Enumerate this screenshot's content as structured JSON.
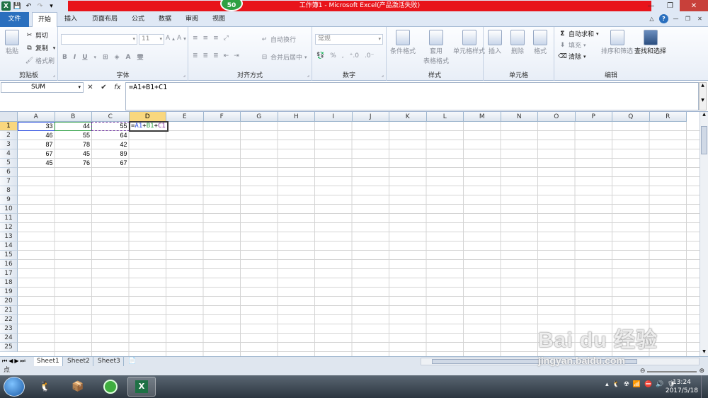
{
  "window": {
    "title": "工作簿1 - Microsoft Excel(产品激活失败)",
    "badge": "50"
  },
  "tabs": [
    {
      "label": "文件"
    },
    {
      "label": "开始"
    },
    {
      "label": "插入"
    },
    {
      "label": "页面布局"
    },
    {
      "label": "公式"
    },
    {
      "label": "数据"
    },
    {
      "label": "审阅"
    },
    {
      "label": "视图"
    }
  ],
  "ribbon": {
    "clipboard": {
      "title": "剪贴板",
      "paste": "粘贴",
      "cut": "剪切",
      "copy": "复制",
      "format_painter": "格式刷"
    },
    "font": {
      "title": "字体",
      "font_size": "11",
      "bold": "B",
      "italic": "I",
      "underline": "U"
    },
    "alignment": {
      "title": "对齐方式",
      "wrap_text": "自动换行",
      "merge_center": "合并后居中"
    },
    "number": {
      "title": "数字",
      "format": "常规"
    },
    "styles": {
      "title": "样式",
      "conditional": "条件格式",
      "table_line1": "套用",
      "table_line2": "表格格式",
      "cell_styles": "单元格样式"
    },
    "cells": {
      "title": "单元格",
      "insert": "插入",
      "delete": "删除",
      "format": "格式"
    },
    "editing": {
      "title": "编辑",
      "autosum": "自动求和",
      "fill": "填充",
      "clear": "清除",
      "sort_filter": "排序和筛选",
      "find_select": "查找和选择"
    }
  },
  "formula_bar": {
    "name_box": "SUM",
    "formula": "=A1+B1+C1"
  },
  "columns": [
    "A",
    "B",
    "C",
    "D",
    "E",
    "F",
    "G",
    "H",
    "I",
    "J",
    "K",
    "L",
    "M",
    "N",
    "O",
    "P",
    "Q",
    "R"
  ],
  "rows": [
    "1",
    "2",
    "3",
    "4",
    "5",
    "6",
    "7",
    "8",
    "9",
    "10",
    "11",
    "12",
    "13",
    "14",
    "15",
    "16",
    "17",
    "18",
    "19",
    "20",
    "21",
    "22",
    "23",
    "24",
    "25"
  ],
  "cells": {
    "A1": "33",
    "B1": "44",
    "C1": "55",
    "A2": "46",
    "B2": "55",
    "C2": "64",
    "A3": "87",
    "B3": "78",
    "C3": "42",
    "A4": "67",
    "B4": "45",
    "C4": "89",
    "A5": "45",
    "B5": "76",
    "C5": "67"
  },
  "editing_cell": {
    "ref": "D1",
    "parts": [
      {
        "text": "=",
        "color": "#000000"
      },
      {
        "text": "A1",
        "color": "#2b4de0"
      },
      {
        "text": "+",
        "color": "#000000"
      },
      {
        "text": "B1",
        "color": "#2ea043"
      },
      {
        "text": "+",
        "color": "#000000"
      },
      {
        "text": "C1",
        "color": "#8a2ea0"
      }
    ]
  },
  "sheets": [
    "Sheet1",
    "Sheet2",
    "Sheet3"
  ],
  "status": {
    "mode": "点"
  },
  "taskbar": {
    "time": "13:24",
    "date": "2017/5/18"
  },
  "watermark": {
    "line1": "Bai du 经验",
    "line2": "jingyan.baidu.com"
  },
  "colors": {
    "accent": "#2a6fbe",
    "title_red": "#e8141b",
    "badge_green": "#2ea043",
    "excel_green": "#1e7145"
  }
}
